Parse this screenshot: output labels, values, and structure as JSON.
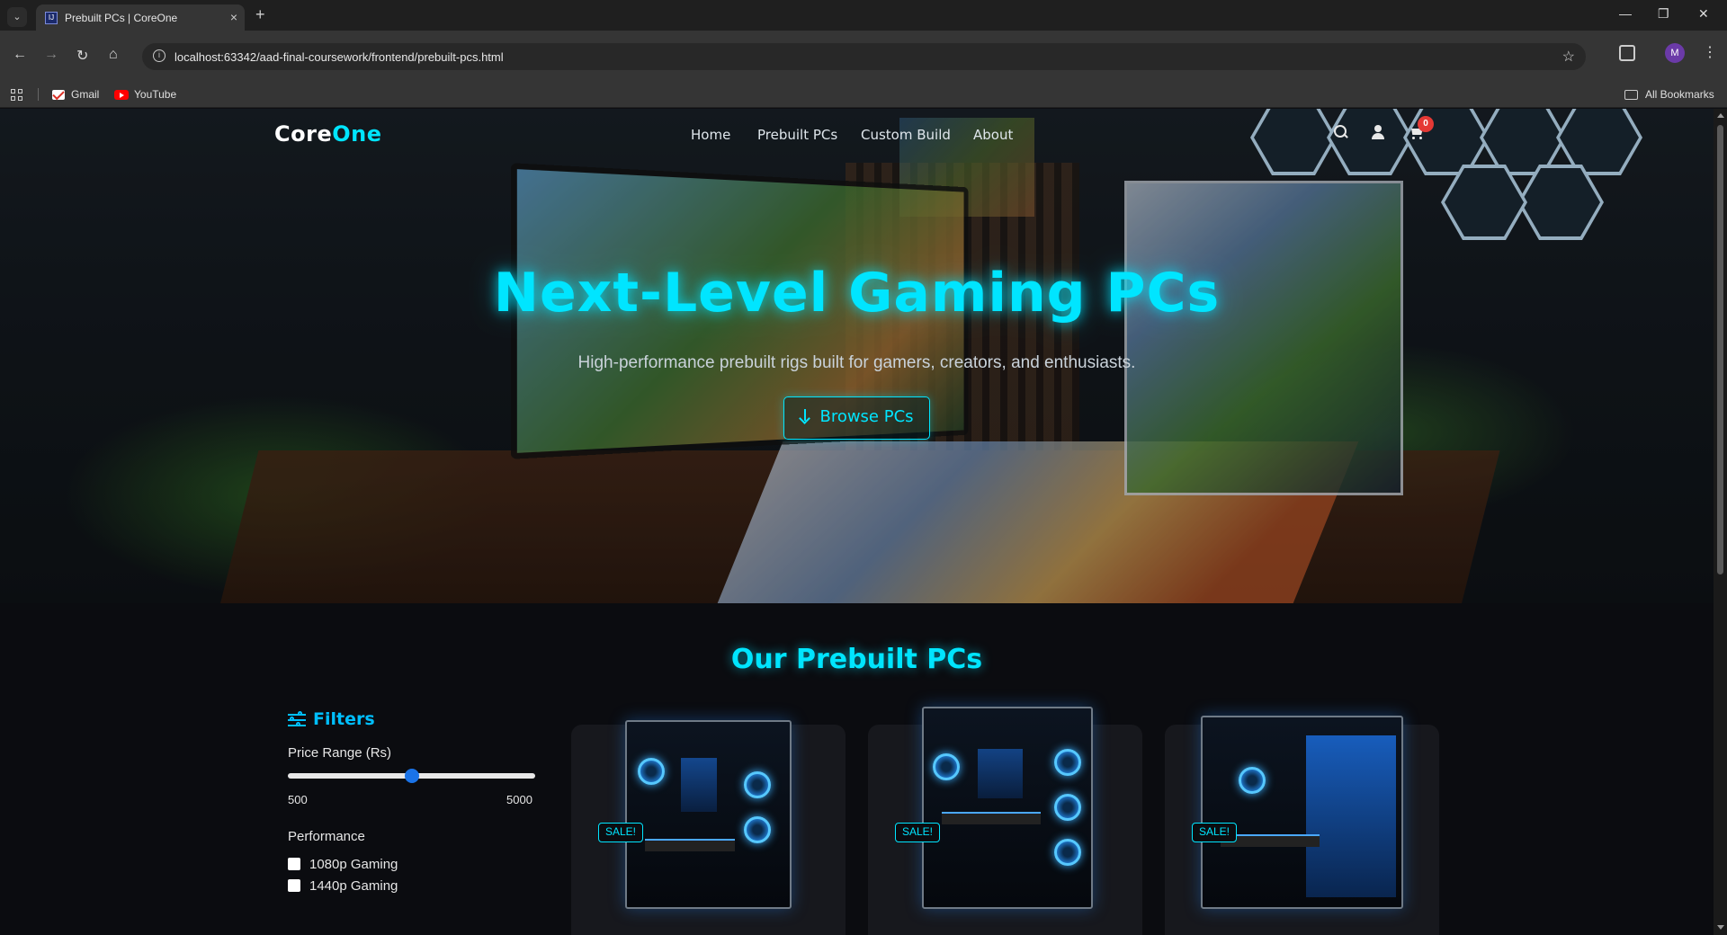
{
  "browser": {
    "tab_title": "Prebuilt PCs | CoreOne",
    "new_tab_symbol": "+",
    "tab_close_symbol": "×",
    "url": "localhost:63342/aad-final-coursework/frontend/prebuilt-pcs.html",
    "profile_initial": "M",
    "bookmarks": [
      "Gmail",
      "YouTube"
    ],
    "all_bookmarks": "All Bookmarks",
    "icons": [
      "tab-list-icon",
      "back-icon",
      "forward-icon",
      "reload-icon",
      "home-icon",
      "site-info-icon",
      "star-icon",
      "extensions-icon",
      "menu-icon",
      "minimize-icon",
      "restore-icon",
      "close-window-icon"
    ]
  },
  "site": {
    "logo_part1": "Core",
    "logo_part2": "One",
    "nav": [
      "Home",
      "Prebuilt PCs",
      "Custom Build",
      "About"
    ],
    "cart_count": "0",
    "accent_color": "#00e5ff"
  },
  "hero": {
    "title": "Next-Level Gaming PCs",
    "subtitle": "High-performance prebuilt rigs built for gamers, creators, and enthusiasts.",
    "button_label": "Browse PCs"
  },
  "products": {
    "section_title": "Our Prebuilt PCs",
    "badge_label": "SALE!",
    "cards": [
      {
        "badge": "SALE!"
      },
      {
        "badge": "SALE!"
      },
      {
        "badge": "SALE!"
      }
    ]
  },
  "filters": {
    "heading": "Filters",
    "price_label": "Price Range (Rs)",
    "price_min": "500",
    "price_max": "5000",
    "price_current_fraction": 0.5,
    "performance_label": "Performance",
    "performance_options": [
      "1080p Gaming",
      "1440p Gaming"
    ]
  }
}
